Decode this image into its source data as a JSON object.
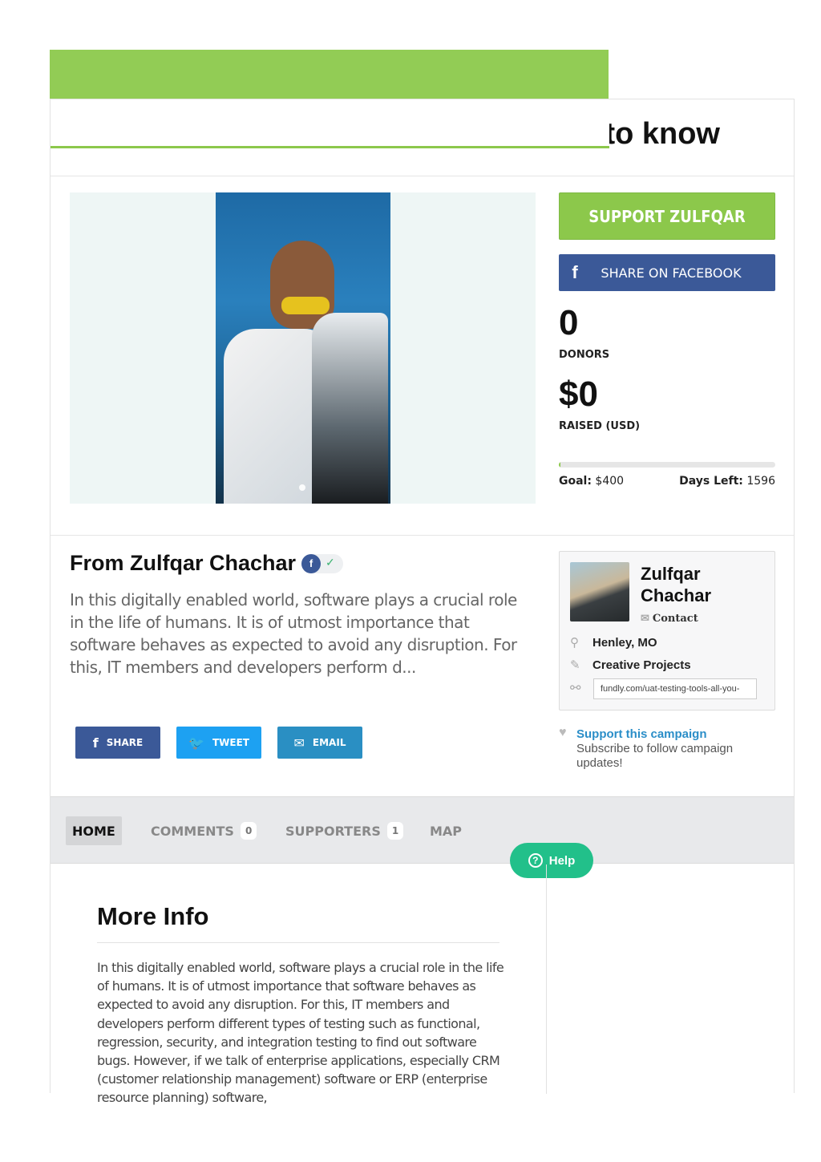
{
  "campaign": {
    "title": "to know"
  },
  "actions": {
    "support_label": "SUPPORT ZULFQAR",
    "share_facebook_label": "SHARE ON FACEBOOK",
    "facebook_glyph": "f"
  },
  "stats": {
    "donors_count": "0",
    "donors_label": "DONORS",
    "raised_amount": "$0",
    "raised_label": "RAISED (USD)",
    "goal_label": "Goal:",
    "goal_value": "$400",
    "days_left_label": "Days Left:",
    "days_left_value": "1596",
    "progress_fraction": 0.005
  },
  "story": {
    "heading": "From Zulfqar Chachar",
    "summary": "In this digitally enabled world, software plays a crucial role in the life of humans. It is of utmost importance that software behaves as expected to avoid any disruption. For this, IT members and developers perform d..."
  },
  "share_buttons": [
    {
      "label": "SHARE",
      "icon": "facebook-icon",
      "color": "#3b5998"
    },
    {
      "label": "TWEET",
      "icon": "twitter-icon",
      "color": "#1da1f2"
    },
    {
      "label": "EMAIL",
      "icon": "envelope-icon",
      "color": "#2a8fc3"
    }
  ],
  "profile": {
    "name": "Zulfqar Chachar",
    "contact_label": "Contact",
    "location": "Henley, MO",
    "category": "Creative Projects",
    "url": "fundly.com/uat-testing-tools-all-you-"
  },
  "follow": {
    "link_label": "Support this campaign",
    "subtext": "Subscribe to follow campaign updates!"
  },
  "tabs": [
    {
      "label": "HOME",
      "count": null,
      "active": true
    },
    {
      "label": "COMMENTS",
      "count": "0",
      "active": false
    },
    {
      "label": "SUPPORTERS",
      "count": "1",
      "active": false
    },
    {
      "label": "MAP",
      "count": null,
      "active": false
    }
  ],
  "help": {
    "label": "Help"
  },
  "more_info": {
    "heading": "More Info",
    "body": "In this digitally enabled world, software plays a crucial role in the life of humans. It is of utmost importance that software behaves as expected to avoid any disruption. For this, IT members and developers perform different types of testing such as functional, regression, security, and integration testing to find out software bugs. However, if we talk of enterprise applications, especially CRM (customer relationship management) software or ERP (enterprise resource planning) software,"
  },
  "colors": {
    "brand_green": "#8cc84b",
    "facebook_blue": "#3b5998",
    "help_green": "#22c08a",
    "link_blue": "#2b8ec8"
  }
}
